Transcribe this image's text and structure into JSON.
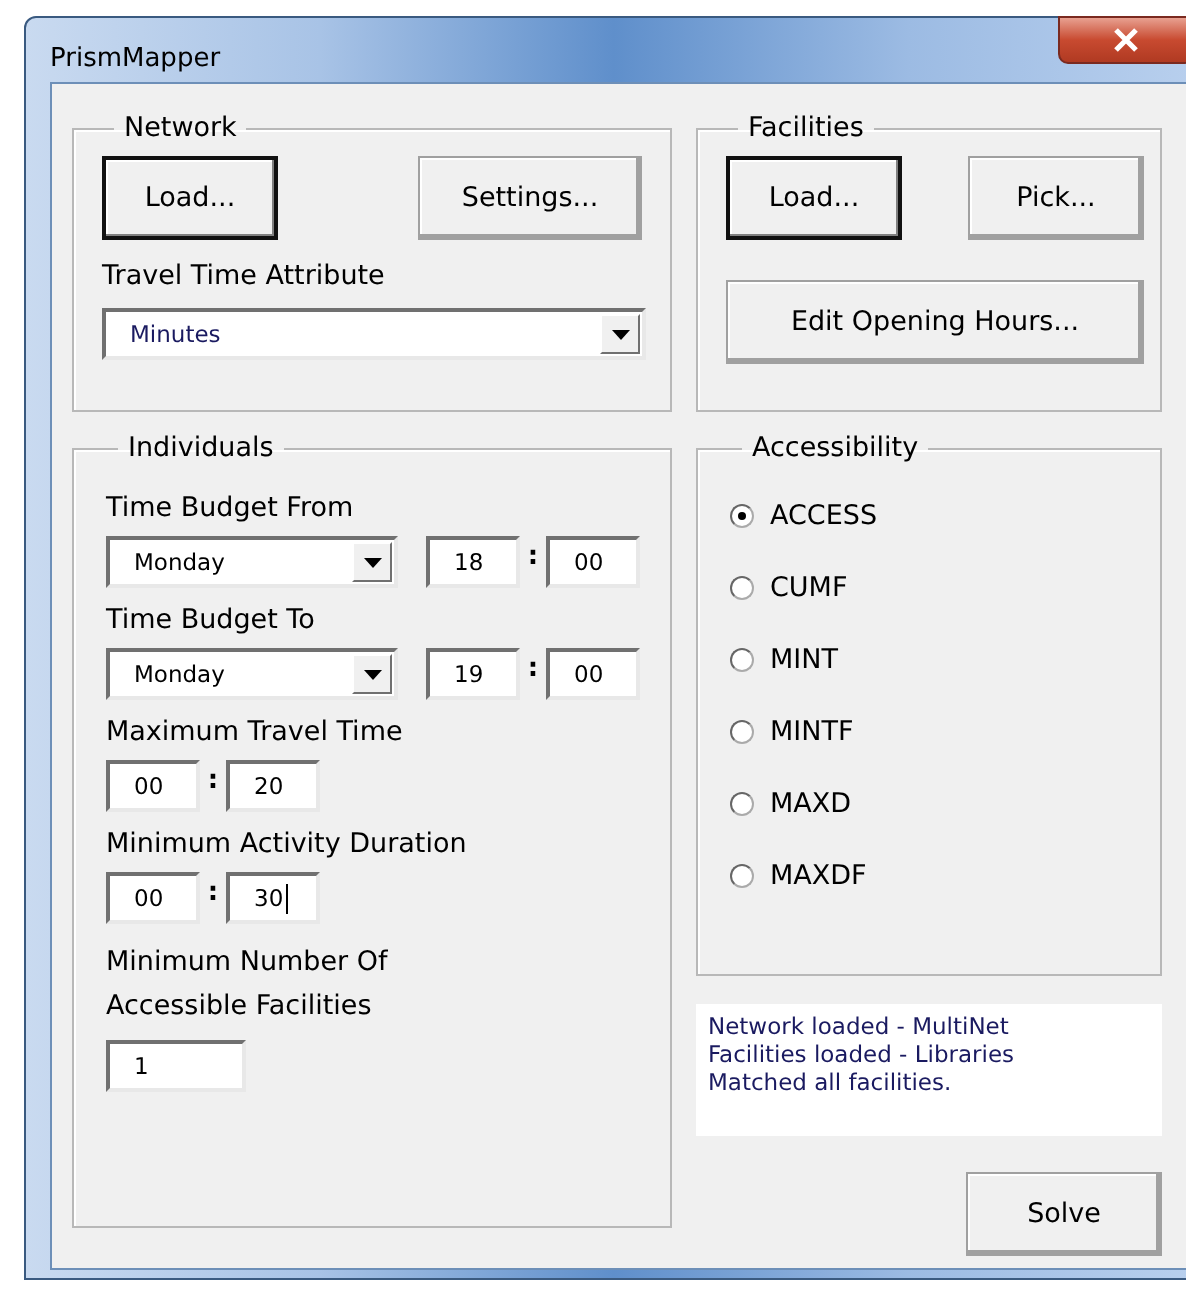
{
  "window": {
    "title": "PrismMapper"
  },
  "network": {
    "title": "Network",
    "buttons": [
      {
        "label": "Load...",
        "default": true
      },
      {
        "label": "Settings...",
        "default": false
      }
    ],
    "attribute_label": "Travel Time Attribute",
    "attribute": {
      "value": "Minutes"
    }
  },
  "facilities": {
    "title": "Facilities",
    "buttons": [
      {
        "label": "Load...",
        "default": true
      },
      {
        "label": "Pick...",
        "default": false
      }
    ],
    "edit_button": {
      "label": "Edit Opening Hours...",
      "default": false
    }
  },
  "individuals": {
    "title": "Individuals",
    "rows": [
      {
        "kind": "day_time",
        "label": "Time Budget From",
        "day": "Monday",
        "hour": "18",
        "separator": ":",
        "minute": "00",
        "caret": false
      },
      {
        "kind": "day_time",
        "label": "Time Budget To",
        "day": "Monday",
        "hour": "19",
        "separator": ":",
        "minute": "00",
        "caret": false
      },
      {
        "kind": "duration",
        "label": "Maximum Travel Time",
        "hour": "00",
        "separator": ":",
        "minute": "20",
        "caret": false
      },
      {
        "kind": "duration",
        "label": "Minimum Activity Duration",
        "hour": "00",
        "separator": ":",
        "minute": "30",
        "caret": true
      },
      {
        "kind": "number",
        "label": "Minimum Number Of Accessible Facilities",
        "value": "1",
        "caret": false
      }
    ]
  },
  "accessibility": {
    "title": "Accessibility",
    "options": [
      {
        "label": "ACCESS",
        "selected": true
      },
      {
        "label": "CUMF",
        "selected": false
      },
      {
        "label": "MINT",
        "selected": false
      },
      {
        "label": "MINTF",
        "selected": false
      },
      {
        "label": "MAXD",
        "selected": false
      },
      {
        "label": "MAXDF",
        "selected": false
      }
    ]
  },
  "status_lines": [
    "Network loaded - MultiNet",
    "Facilities loaded - Libraries",
    "Matched all facilities."
  ],
  "solve_button": {
    "label": "Solve",
    "default": false
  }
}
